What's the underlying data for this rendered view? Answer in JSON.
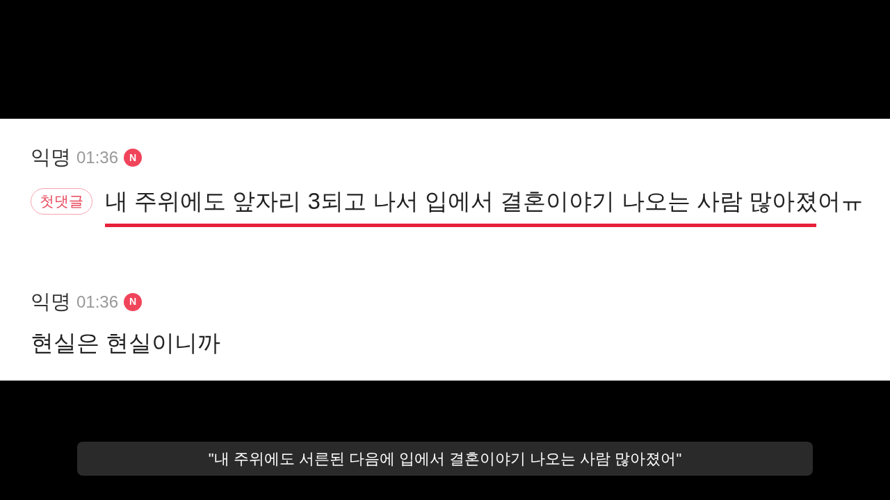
{
  "comments": [
    {
      "author": "익명",
      "time": "01:36",
      "new_badge": "N",
      "tag": "첫댓글",
      "text": "내 주위에도 앞자리 3되고 나서 입에서 결혼이야기 나오는 사람 많아졌어ㅠ",
      "underlined": true
    },
    {
      "author": "익명",
      "time": "01:36",
      "new_badge": "N",
      "text": "현실은 현실이니까",
      "underlined": false
    }
  ],
  "subtitle": "\"내 주위에도 서른된 다음에 입에서 결혼이야기 나오는 사람 많아졌어\""
}
